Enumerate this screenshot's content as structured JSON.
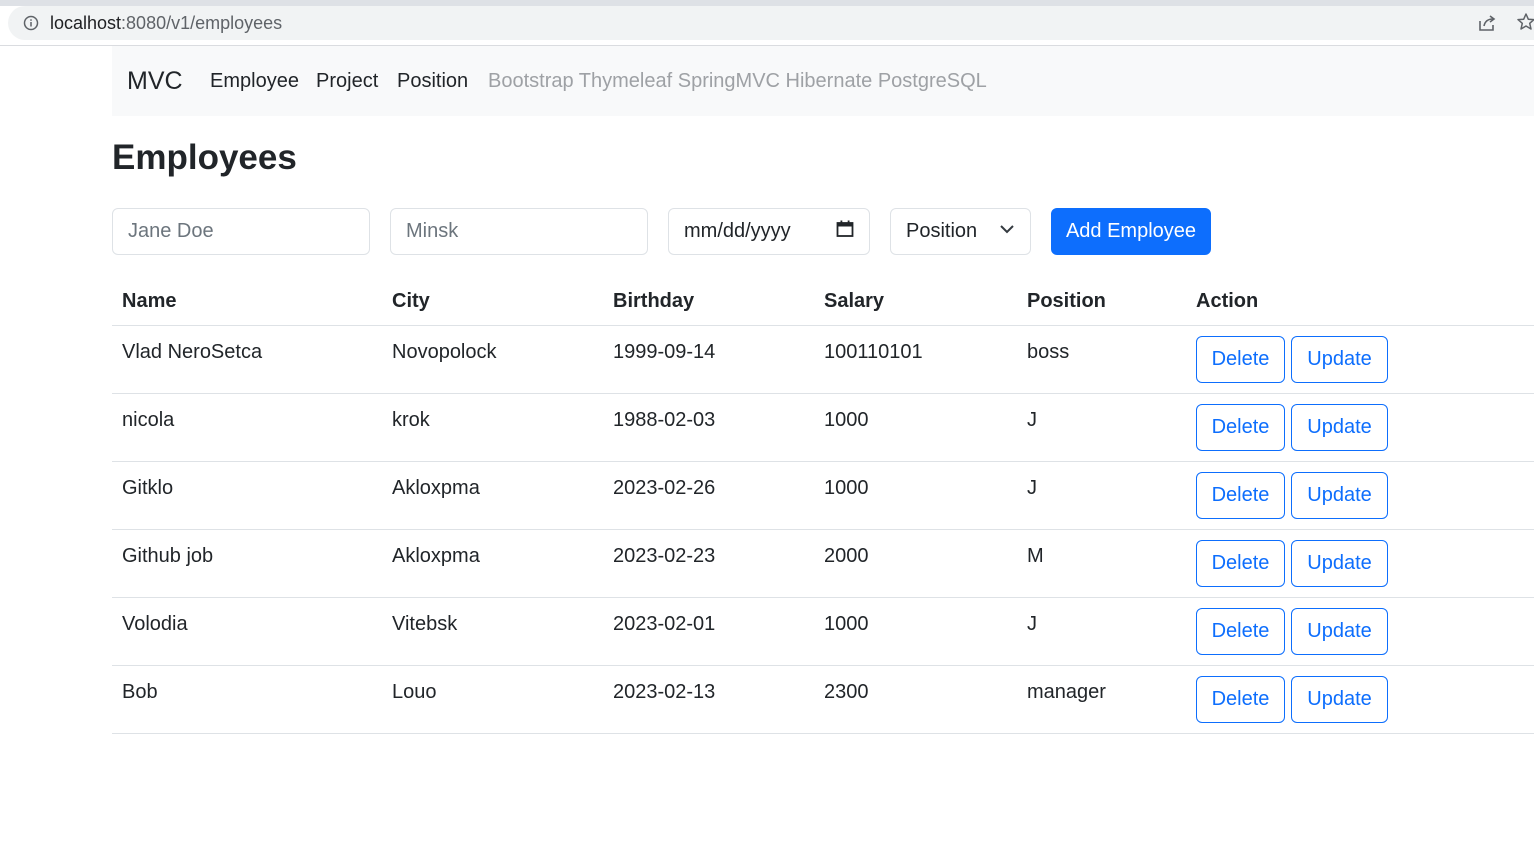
{
  "browser": {
    "url_host": "localhost",
    "url_rest": ":8080/v1/employees"
  },
  "navbar": {
    "brand": "MVC",
    "links": [
      "Employee",
      "Project",
      "Position"
    ],
    "tagline": "Bootstrap Thymeleaf SpringMVC Hibernate PostgreSQL"
  },
  "page": {
    "title": "Employees"
  },
  "form": {
    "name_placeholder": "Jane Doe",
    "city_placeholder": "Minsk",
    "date_placeholder": "mm/dd/yyyy",
    "position_selected": "Position",
    "add_label": "Add Employee"
  },
  "colors": {
    "primary": "#0d6efd",
    "navbar_bg": "#f8f9fa",
    "border": "#dee2e6"
  },
  "table": {
    "headers": [
      "Name",
      "City",
      "Birthday",
      "Salary",
      "Position",
      "Action"
    ],
    "delete_label": "Delete",
    "update_label": "Update",
    "rows": [
      [
        "Vlad NeroSetca",
        "Novopolock",
        "1999-09-14",
        "100110101",
        "boss"
      ],
      [
        "nicola",
        "krok",
        "1988-02-03",
        "1000",
        "J"
      ],
      [
        "Gitklo",
        "Akloxpma",
        "2023-02-26",
        "1000",
        "J"
      ],
      [
        "Github job",
        "Akloxpma",
        "2023-02-23",
        "2000",
        "M"
      ],
      [
        "Volodia",
        "Vitebsk",
        "2023-02-01",
        "1000",
        "J"
      ],
      [
        "Bob",
        "Louo",
        "2023-02-13",
        "2300",
        "manager"
      ]
    ]
  }
}
